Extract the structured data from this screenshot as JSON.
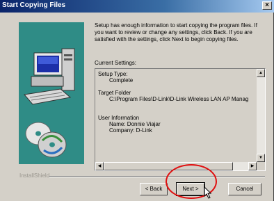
{
  "window": {
    "title": "Start Copying Files",
    "close_glyph": "×"
  },
  "description": "Setup has enough information to start copying the program files. If you want to review or change any settings, click Back.  If you are satisfied with the settings, click Next to begin copying files.",
  "current_settings": {
    "label": "Current Settings:",
    "lines": {
      "setup_type_label": "Setup Type:",
      "setup_type_value": "Complete",
      "target_folder_label": "Target Folder",
      "target_folder_value": "C:\\Program Files\\D-Link\\D-Link Wireless LAN AP Manag",
      "user_info_label": "User Information",
      "name": "Name:  Donnie Viajar",
      "company": "Company:  D-Link"
    }
  },
  "footer": {
    "brand": "InstallShield"
  },
  "buttons": {
    "back": "< Back",
    "next": "Next >",
    "cancel": "Cancel"
  },
  "colors": {
    "art_panel": "#2f8c86",
    "annotation_circle": "#e01010"
  },
  "icons": [
    "computer-illustration",
    "cd-disc-icon",
    "close-icon",
    "scroll-up-icon",
    "scroll-down-icon",
    "scroll-left-icon",
    "scroll-right-icon",
    "mouse-cursor-icon"
  ]
}
